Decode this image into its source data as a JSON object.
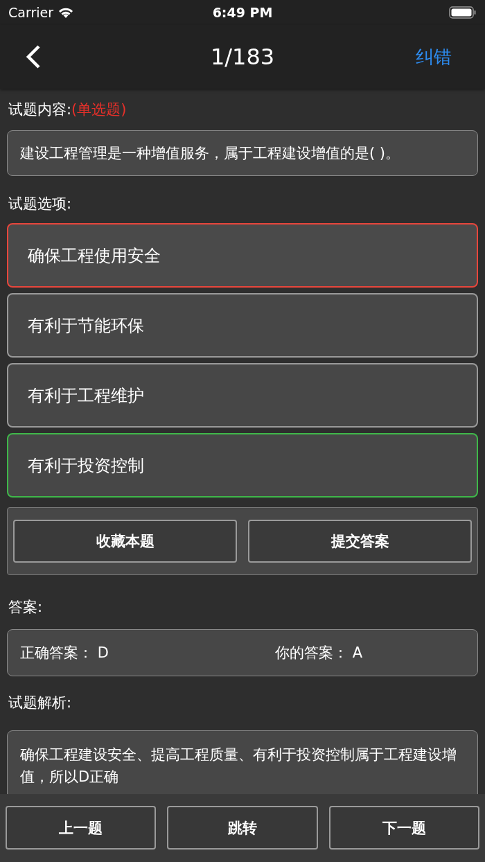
{
  "status_bar": {
    "carrier": "Carrier",
    "time": "6:49 PM"
  },
  "nav": {
    "title": "1/183",
    "action": "纠错"
  },
  "question": {
    "label": "试题内容:",
    "type": "(单选题)",
    "text": "建设工程管理是一种增值服务，属于工程建设增值的是( )。"
  },
  "options_label": "试题选项:",
  "options": [
    {
      "text": "确保工程使用安全",
      "selected": true,
      "correct": false
    },
    {
      "text": "有利于节能环保",
      "selected": false,
      "correct": false
    },
    {
      "text": "有利于工程维护",
      "selected": false,
      "correct": false
    },
    {
      "text": "有利于投资控制",
      "selected": false,
      "correct": true
    }
  ],
  "actions": [
    "收藏本题",
    "提交答案"
  ],
  "answer": {
    "label": "答案:",
    "correct_label": "正确答案：",
    "correct": "D",
    "yours_label": "你的答案：",
    "yours": "A"
  },
  "explanation": {
    "label": "试题解析:",
    "text": "确保工程建设安全、提高工程质量、有利于投资控制属于工程建设增值，所以D正确"
  },
  "bottom_buttons": [
    "上一题",
    "跳转",
    "下一题"
  ]
}
